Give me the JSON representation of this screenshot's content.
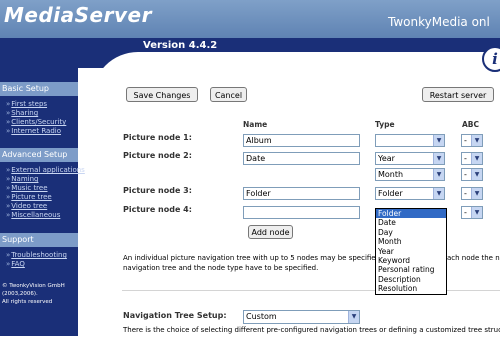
{
  "header": {
    "logo": "MediaServer",
    "brand": "TwonkyMedia onl",
    "version": "Version 4.4.2",
    "info_symbol": "i"
  },
  "sidebar": {
    "basic_setup": {
      "title": "Basic Setup",
      "items": [
        "First steps",
        "Sharing",
        "Clients/Security",
        "Internet Radio"
      ]
    },
    "advanced_setup": {
      "title": "Advanced Setup",
      "items": [
        "External applications",
        "Naming",
        "Music tree",
        "Picture tree",
        "Video tree",
        "Miscellaneous"
      ]
    },
    "support": {
      "title": "Support",
      "items": [
        "Troubleshooting",
        "FAQ"
      ]
    },
    "copyright": [
      "© TwonkyVision GmbH",
      "(2003,2006).",
      "All rights reserved"
    ]
  },
  "toolbar": {
    "save_label": "Save Changes",
    "cancel_label": "Cancel",
    "restart_label": "Restart server"
  },
  "columns": {
    "name": "Name",
    "type": "Type",
    "abc": "ABC"
  },
  "nodes": [
    {
      "label": "Picture node 1:",
      "name": "Album",
      "types": [
        ""
      ],
      "abc": "-"
    },
    {
      "label": "Picture node 2:",
      "name": "Date",
      "types": [
        "Year",
        "Month"
      ],
      "abc": "-"
    },
    {
      "label": "Picture node 3:",
      "name": "Folder",
      "types": [
        "Folder"
      ],
      "abc": "-"
    },
    {
      "label": "Picture node 4:",
      "name": "",
      "types": [],
      "abc": "-"
    }
  ],
  "add_node_label": "Add node",
  "dropdown_options": [
    "Folder",
    "Date",
    "Day",
    "Month",
    "Year",
    "Keyword",
    "Personal rating",
    "Description",
    "Resolution"
  ],
  "dropdown_selected": "Folder",
  "description": {
    "line1_left": "An individual picture navigation tree with up to 5 nodes may be specified",
    "line1_right": "ach node the na",
    "line2": "navigation tree and the node type have to be specified."
  },
  "nav_setup": {
    "label": "Navigation Tree Setup:",
    "value": "Custom",
    "description": "There is the choice of selecting different pre-configured navigation trees or defining a customized tree struct"
  },
  "colors": {
    "header_band": "#1a2f78",
    "header_top": "#6f92bf",
    "sidebar_bg": "#1a2f78",
    "sidebar_heading": "#7d9cc8",
    "selection": "#316ac5"
  }
}
